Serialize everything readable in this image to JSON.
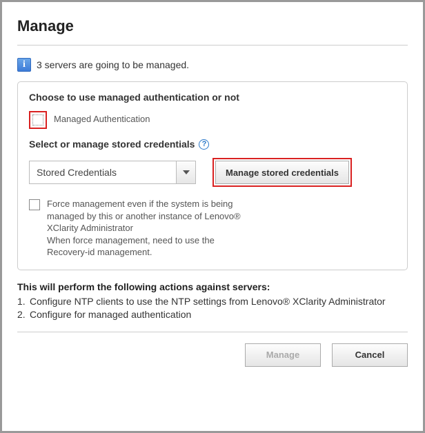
{
  "title": "Manage",
  "info": {
    "text": "3 servers are going to be managed."
  },
  "panel": {
    "auth_heading": "Choose to use managed authentication or not",
    "managed_auth_label": "Managed Authentication",
    "cred_heading": "Select or manage stored credentials",
    "dropdown_selected": "Stored Credentials",
    "manage_cred_button": "Manage stored credentials",
    "force_label": "Force management even if the system is being managed by this or another instance of Lenovo® XClarity Administrator",
    "force_sub": "When force management, need to use the Recovery-id management."
  },
  "actions": {
    "heading": "This will perform the following actions against servers:",
    "items": [
      "Configure NTP clients to use the NTP settings from Lenovo® XClarity Administrator",
      "Configure for managed authentication"
    ]
  },
  "footer": {
    "manage": "Manage",
    "cancel": "Cancel"
  }
}
